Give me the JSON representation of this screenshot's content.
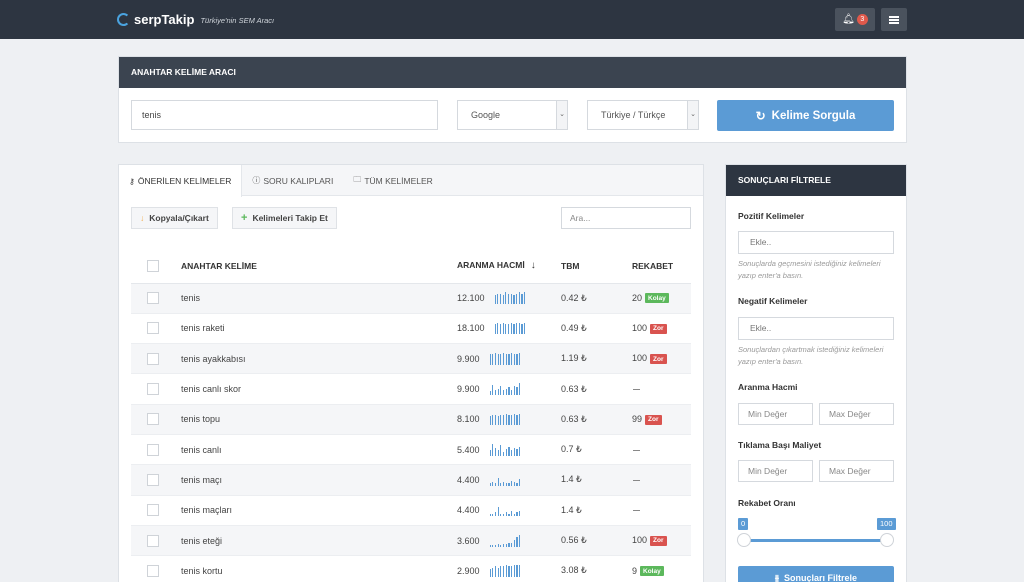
{
  "brand": {
    "name": "serpTakip",
    "tagline": "Türkiye'nin SEM Aracı",
    "notification_count": "3"
  },
  "tool": {
    "title": "ANAHTAR KELİME ARACI",
    "keyword_value": "tenis",
    "engine_value": "Google",
    "language_value": "Türkiye / Türkçe",
    "query_button": "Kelime Sorgula"
  },
  "results": {
    "tabs": [
      {
        "label": "ÖNERİLEN KELİMELER",
        "icon": "key-icon",
        "active": true
      },
      {
        "label": "SORU KALIPLARI",
        "icon": "question-icon",
        "active": false
      },
      {
        "label": "TÜM KELİMELER",
        "icon": "folder-icon",
        "active": false
      }
    ],
    "copy_button": "Kopyala/Çıkart",
    "track_button": "Kelimeleri Takip Et",
    "search_placeholder": "Ara...",
    "columns": {
      "keyword": "ANAHTAR KELİME",
      "volume": "ARANMA HACMİ",
      "cpc": "TBM",
      "competition": "REKABET"
    },
    "rows": [
      {
        "keyword": "tenis",
        "volume": "12.100",
        "cpc": "0.42 ₺",
        "competition": "20",
        "badge": "Kolay",
        "badge_type": "easy",
        "trend": [
          7,
          8,
          8,
          7,
          9,
          8,
          8,
          7,
          8,
          9,
          8,
          9
        ]
      },
      {
        "keyword": "tenis raketi",
        "volume": "18.100",
        "cpc": "0.49 ₺",
        "competition": "100",
        "badge": "Zor",
        "badge_type": "hard",
        "trend": [
          8,
          9,
          8,
          9,
          8,
          8,
          9,
          8,
          9,
          9,
          8,
          9
        ]
      },
      {
        "keyword": "tenis ayakkabısı",
        "volume": "9.900",
        "cpc": "1.19 ₺",
        "competition": "100",
        "badge": "Zor",
        "badge_type": "hard",
        "trend": [
          8,
          8,
          9,
          8,
          8,
          9,
          8,
          8,
          9,
          8,
          8,
          9
        ]
      },
      {
        "keyword": "tenis canlı skor",
        "volume": "9.900",
        "cpc": "0.63 ₺",
        "competition": "",
        "badge": "",
        "badge_type": "",
        "trend": [
          3,
          8,
          4,
          5,
          7,
          4,
          5,
          6,
          4,
          7,
          6,
          9
        ]
      },
      {
        "keyword": "tenis topu",
        "volume": "8.100",
        "cpc": "0.63 ₺",
        "competition": "99",
        "badge": "Zor",
        "badge_type": "hard",
        "trend": [
          7,
          8,
          8,
          7,
          8,
          8,
          9,
          8,
          8,
          9,
          8,
          9
        ]
      },
      {
        "keyword": "tenis canlı",
        "volume": "5.400",
        "cpc": "0.7 ₺",
        "competition": "",
        "badge": "",
        "badge_type": "",
        "trend": [
          4,
          9,
          6,
          4,
          8,
          3,
          5,
          7,
          4,
          6,
          5,
          7
        ]
      },
      {
        "keyword": "tenis maçı",
        "volume": "4.400",
        "cpc": "1.4 ₺",
        "competition": "",
        "badge": "",
        "badge_type": "",
        "trend": [
          2,
          3,
          2,
          6,
          2,
          3,
          2,
          2,
          4,
          3,
          2,
          5
        ]
      },
      {
        "keyword": "tenis maçları",
        "volume": "4.400",
        "cpc": "1.4 ₺",
        "competition": "",
        "badge": "",
        "badge_type": "",
        "trend": [
          2,
          2,
          3,
          7,
          2,
          2,
          3,
          2,
          4,
          2,
          3,
          4
        ]
      },
      {
        "keyword": "tenis eteği",
        "volume": "3.600",
        "cpc": "0.56 ₺",
        "competition": "100",
        "badge": "Zor",
        "badge_type": "hard",
        "trend": [
          1,
          1,
          1,
          2,
          1,
          2,
          2,
          3,
          3,
          5,
          7,
          9
        ]
      },
      {
        "keyword": "tenis kortu",
        "volume": "2.900",
        "cpc": "3.08 ₺",
        "competition": "9",
        "badge": "Kolay",
        "badge_type": "easy",
        "trend": [
          6,
          7,
          8,
          7,
          8,
          8,
          9,
          8,
          8,
          9,
          9,
          9
        ]
      }
    ]
  },
  "filter": {
    "title": "SONUÇLARI FİLTRELE",
    "positive_label": "Pozitif Kelimeler",
    "positive_placeholder": "Ekle..",
    "positive_hint": "Sonuçlarda geçmesini istediğiniz kelimeleri yazıp enter'a basın.",
    "negative_label": "Negatif Kelimeler",
    "negative_placeholder": "Ekle..",
    "negative_hint": "Sonuçlardan çıkartmak istediğiniz kelimeleri yazıp enter'a basın.",
    "volume_label": "Aranma Hacmi",
    "cpc_label": "Tıklama Başı Maliyet",
    "min_placeholder": "Min Değer",
    "max_placeholder": "Max Değer",
    "competition_label": "Rekabet Oranı",
    "range_min": "0",
    "range_max": "100",
    "button": "Sonuçları Filtrele"
  }
}
